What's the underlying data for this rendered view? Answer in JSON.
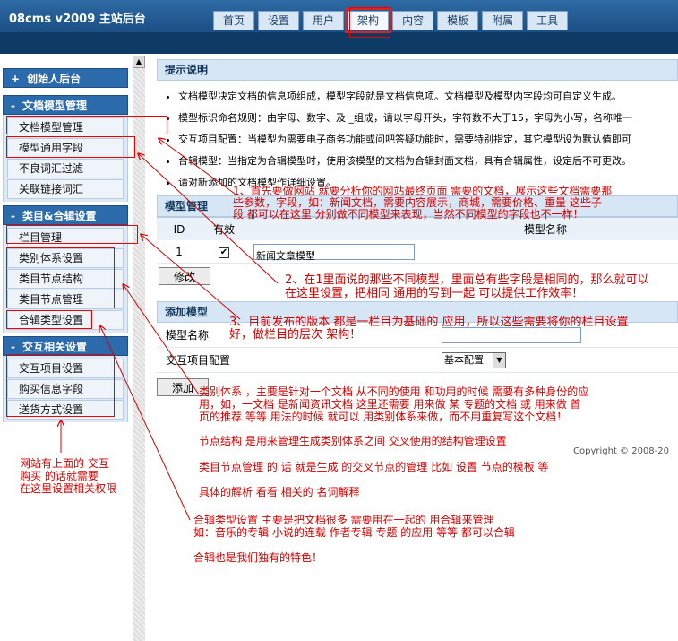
{
  "header": {
    "logo": "08cms  v2009  主站后台",
    "tabs": [
      "首页",
      "设置",
      "用户",
      "架构",
      "内容",
      "模板",
      "附属",
      "工具"
    ],
    "active_tab": "架构"
  },
  "sidebar": {
    "founder": "创始人后台",
    "groups": [
      {
        "title": "文档模型管理",
        "items": [
          "文档模型管理",
          "模型通用字段",
          "不良词汇过滤",
          "关联链接词汇"
        ]
      },
      {
        "title": "类目&合辑设置",
        "items": [
          "栏目管理",
          "类别体系设置",
          "类目节点结构",
          "类目节点管理",
          "合辑类型设置"
        ]
      },
      {
        "title": "交互相关设置",
        "items": [
          "交互项目设置",
          "购买信息字段",
          "送货方式设置"
        ]
      }
    ],
    "founder_sign": "+",
    "group_sign": "-"
  },
  "tips": {
    "title": "提示说明",
    "items": [
      "文档模型决定文档的信息项组成，模型字段就是文档信息项。文档模型及模型内字段均可自定义生成。",
      "模型标识命名规则：由字母、数字、及 _组成，请以字母开头，字符数不大于15，字母为小写，名称唯一",
      "交互项目配置：当模型为需要电子商务功能或问吧答疑功能时，需要特别指定，其它模型设为默认值即可",
      "合辑模型：当指定为合辑模型时，使用该模型的文档为合辑封面文档，具有合辑属性，设定后不可更改。",
      "请对新添加的文档模型作详细设置。"
    ]
  },
  "model_table": {
    "title": "模型管理",
    "headers": [
      "ID",
      "有效",
      "模型名称"
    ],
    "rows": [
      {
        "id": "1",
        "valid": "✔",
        "name": "新闻文章模型"
      }
    ],
    "edit_button": "修改"
  },
  "add_model": {
    "title": "添加模型",
    "name_label": "模型名称",
    "config_label": "交互项目配置",
    "config_value": "基本配置",
    "add_button": "添加"
  },
  "copyright": "Copyright © 2008-20",
  "annotations": [
    "1、首先要做网站 就要分析你的网站最终页面 需要的文档，展示这些文档需要那",
    "些参数，字段，如：新闻文档，需要内容展示，商城，需要价格、重量 这些子",
    "段 都可以在这里 分别做不同模型来表现，当然不同模型的字段也不一样！",
    "2、在1里面说的那些不同模型，里面总有些字段是相同的，那么就可以",
    "在这里设置，把相同 通用的写到一起 可以提供工作效率！",
    "3、目前发布的版本 都是一栏目为基础的 应用，所以这些需要将你的栏目设置",
    "好，做栏目的层次 架构！",
    "类别体系 ，主要是针对一个文档 从不同的使用 和功用的时候 需要有多种身份的应",
    "用，如，一文档 是新闻资讯文档 这里还需要 用来做 某 专题的文档 或 用来做 首",
    "页的推荐 等等 用法的时候 就可以 用类别体系来做，而不用重复写这个文档！",
    "节点结构 是用来管理生成类别体系之间 交叉使用的结构管理设置",
    "类目节点管理 的 话 就是生成 的交叉节点的管理 比如 设置 节点的模板 等",
    "具体的解析 看看 相关的 名词解释",
    "合辑类型设置 主要是把文档很多 需要用在一起的 用合辑来管理",
    "如：音乐的专辑 小说的连载 作者专辑 专题 的应用 等等 都可以合辑",
    "合辑也是我们独有的特色！",
    "网站有上面的 交互",
    "购买 的话就需要",
    "在这里设置相关权限"
  ]
}
